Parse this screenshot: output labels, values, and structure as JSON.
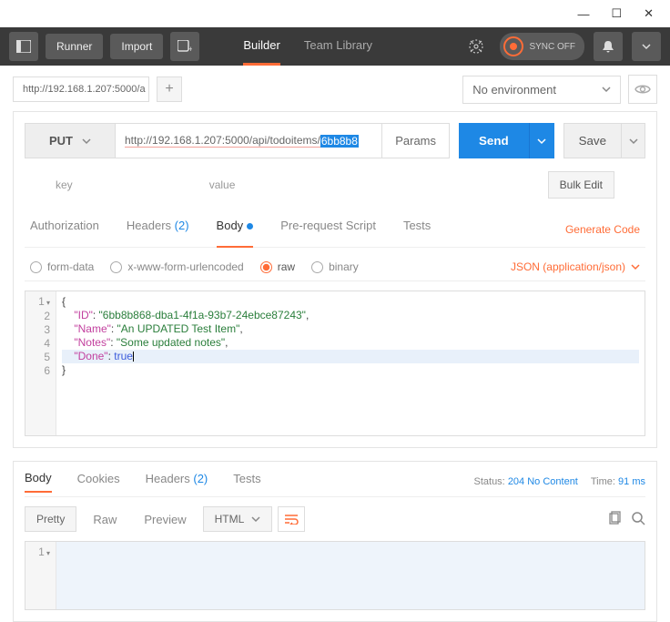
{
  "window": {
    "min": "—",
    "max": "☐",
    "close": "✕"
  },
  "topbar": {
    "runner": "Runner",
    "import": "Import",
    "builder": "Builder",
    "team_library": "Team Library",
    "sync": "SYNC OFF"
  },
  "tabs": {
    "current": "http://192.168.1.207:5000/a"
  },
  "env": {
    "label": "No environment"
  },
  "request": {
    "method": "PUT",
    "url_prefix": "http://",
    "url_mid": "192.168.1.207:5000/api/todoitems/",
    "url_hi": "6bb8b8",
    "params": "Params",
    "send": "Send",
    "save": "Save"
  },
  "kv": {
    "key": "key",
    "value": "value",
    "bulk": "Bulk Edit"
  },
  "req_tabs": {
    "auth": "Authorization",
    "headers": "Headers",
    "headers_count": "(2)",
    "body": "Body",
    "prs": "Pre-request Script",
    "tests": "Tests",
    "gen": "Generate Code"
  },
  "body_types": {
    "form": "form-data",
    "xform": "x-www-form-urlencoded",
    "raw": "raw",
    "binary": "binary",
    "json": "JSON (application/json)"
  },
  "payload": {
    "id_key": "\"ID\"",
    "id_val": "\"6bb8b868-dba1-4f1a-93b7-24ebce87243\"",
    "name_key": "\"Name\"",
    "name_val": "\"An UPDATED Test Item\"",
    "notes_key": "\"Notes\"",
    "notes_val": "\"Some updated notes\"",
    "done_key": "\"Done\"",
    "done_val": "true"
  },
  "resp_tabs": {
    "body": "Body",
    "cookies": "Cookies",
    "headers": "Headers",
    "headers_count": "(2)",
    "tests": "Tests"
  },
  "status": {
    "label": "Status:",
    "value": "204 No Content",
    "time_label": "Time:",
    "time_value": "91 ms"
  },
  "resp_toolbar": {
    "pretty": "Pretty",
    "raw": "Raw",
    "preview": "Preview",
    "html": "HTML"
  }
}
